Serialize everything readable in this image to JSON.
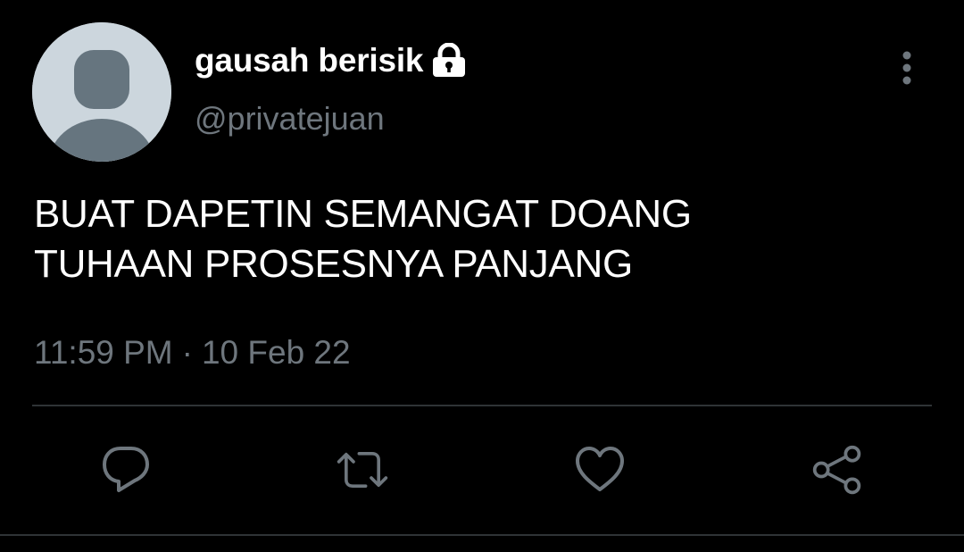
{
  "author": {
    "display_name": "gausah berisik",
    "handle": "@privatejuan",
    "protected_icon": "lock-icon",
    "avatar_icon": "default-avatar-icon"
  },
  "tweet": {
    "text": "BUAT DAPETIN SEMANGAT DOANG\nTUHAAN PROSESNYA PANJANG",
    "time": "11:59 PM",
    "separator": "·",
    "date": "10 Feb 22"
  },
  "actions": [
    {
      "name": "reply",
      "icon": "reply-icon"
    },
    {
      "name": "retweet",
      "icon": "retweet-icon"
    },
    {
      "name": "like",
      "icon": "heart-icon"
    },
    {
      "name": "share",
      "icon": "share-icon"
    }
  ],
  "menu_icon": "more-vertical-icon",
  "colors": {
    "background": "#000000",
    "primary_text": "#ffffff",
    "secondary_text": "#6e767d",
    "divider": "#2f3336",
    "avatar_bg": "#ccd6dd",
    "avatar_fg": "#66757f"
  }
}
